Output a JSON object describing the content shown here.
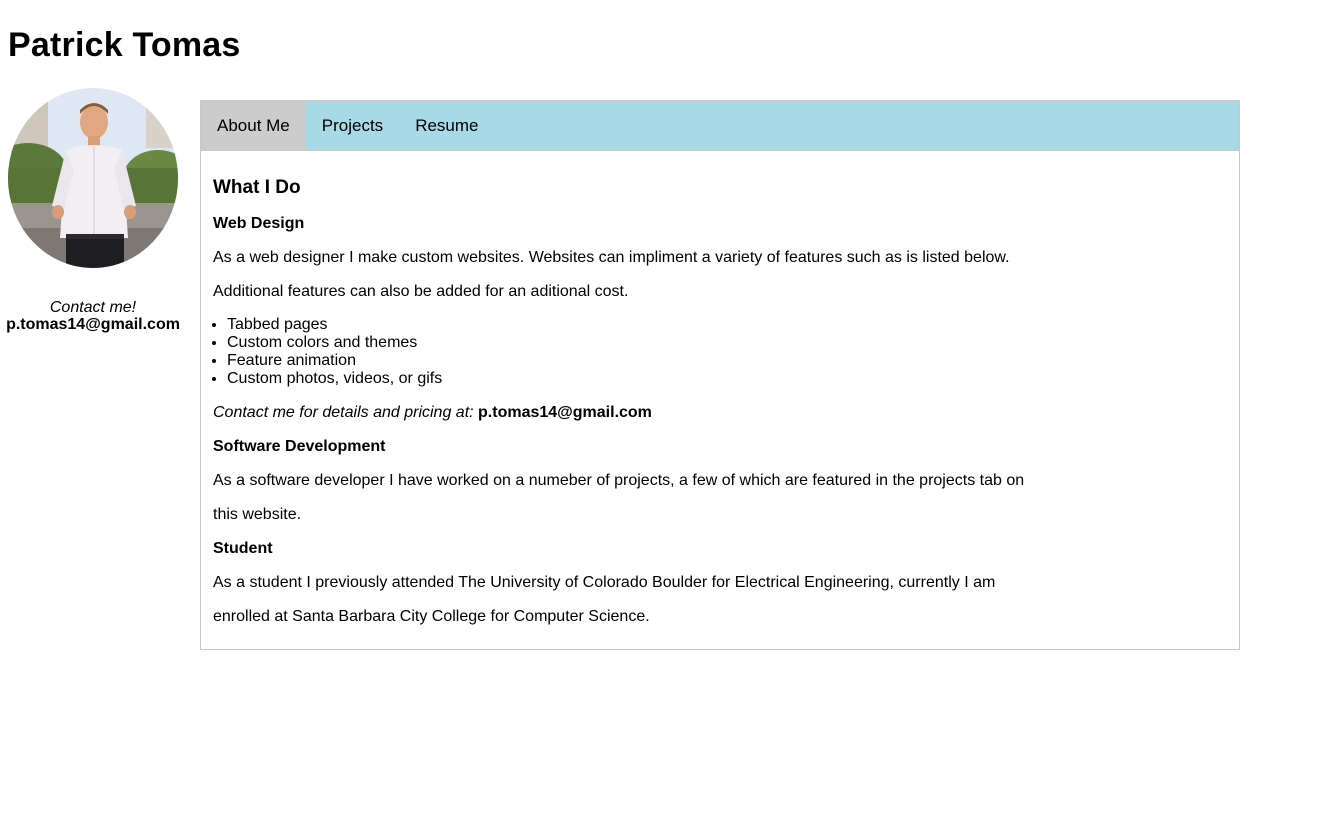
{
  "header": {
    "title": "Patrick Tomas"
  },
  "sidebar": {
    "contact_prompt": "Contact me!",
    "email": "p.tomas14@gmail.com"
  },
  "tabs": [
    {
      "label": "About Me",
      "active": true
    },
    {
      "label": "Projects",
      "active": false
    },
    {
      "label": "Resume",
      "active": false
    }
  ],
  "content": {
    "heading": "What I Do",
    "web_design": {
      "title": "Web Design",
      "para1": "As a web designer I make custom websites. Websites can impliment a variety of features such as is listed below.",
      "para2": "Additional features can also be added for an aditional cost.",
      "features": [
        "Tabbed pages",
        "Custom colors and themes",
        "Feature animation",
        "Custom photos, videos, or gifs"
      ],
      "contact_text": "Contact me for details and pricing at:",
      "contact_email": "p.tomas14@gmail.com"
    },
    "software": {
      "title": "Software Development",
      "line1": "As a software developer I have worked on a numeber of projects, a few of which are featured in the projects tab on",
      "line2": "this website."
    },
    "student": {
      "title": "Student",
      "line1": "As a student I previously attended The University of Colorado Boulder for Electrical Engineering, currently I am",
      "line2": "enrolled at Santa Barbara City College for Computer Science."
    }
  },
  "colors": {
    "tabbar": "#a7d9e6",
    "tab_active": "#cccccc",
    "border": "#c8c8c8"
  }
}
